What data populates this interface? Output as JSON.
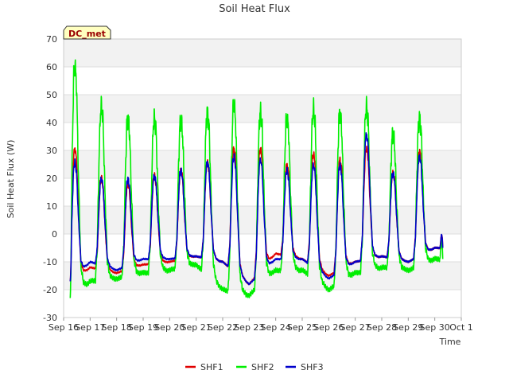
{
  "chart_data": {
    "type": "line",
    "title": "Soil Heat Flux",
    "xlabel": "Time",
    "ylabel": "Soil Heat Flux (W)",
    "badge": "DC_met",
    "ylim": [
      -30,
      70
    ],
    "yticks": [
      -30,
      -20,
      -10,
      0,
      10,
      20,
      30,
      40,
      50,
      60,
      70
    ],
    "xlim": [
      0,
      15
    ],
    "xtick_labels": [
      "Sep 16",
      "Sep 17",
      "Sep 18",
      "Sep 19",
      "Sep 20",
      "Sep 21",
      "Sep 22",
      "Sep 23",
      "Sep 24",
      "Sep 25",
      "Sep 26",
      "Sep 27",
      "Sep 28",
      "Sep 29",
      "Sep 30",
      "Oct 1"
    ],
    "grid": true,
    "legend_position": "bottom-center",
    "data_start": 0.25,
    "data_end": 14.3,
    "day_profile": {
      "phase": [
        0.0,
        0.2,
        0.27,
        0.33,
        0.38,
        0.43,
        0.49,
        0.56,
        0.65,
        0.75,
        0.88,
        1.0
      ],
      "shape": [
        0.0,
        0.0,
        0.2,
        0.65,
        0.95,
        1.0,
        0.9,
        0.5,
        0.1,
        0.02,
        0.0,
        0.0
      ]
    },
    "series": [
      {
        "name": "SHF1",
        "color": "#e00000",
        "width": 1.6,
        "daily_min": [
          -20,
          -12,
          -14,
          -11,
          -10,
          -8,
          -10,
          -18,
          -7,
          -9,
          -15,
          -10,
          -8,
          -10,
          -5
        ],
        "daily_max": [
          31,
          20,
          18,
          21,
          23,
          26,
          31,
          31,
          25,
          29,
          27,
          31,
          22,
          30
        ],
        "start_value": -17,
        "end_value": -5
      },
      {
        "name": "SHF2",
        "color": "#00ee00",
        "width": 1.6,
        "daily_min": [
          -25,
          -17,
          -16,
          -14,
          -13,
          -11,
          -20,
          -22,
          -13,
          -13,
          -20,
          -14,
          -12,
          -13,
          -9
        ],
        "daily_max": [
          61,
          46,
          42,
          42,
          41,
          44,
          47,
          44,
          42,
          45,
          44,
          46,
          36,
          42
        ],
        "start_value": -23,
        "end_value": -9
      },
      {
        "name": "SHF3",
        "color": "#0000cc",
        "width": 1.6,
        "daily_min": [
          -20,
          -10,
          -13,
          -9,
          -9,
          -8,
          -10,
          -18,
          -9,
          -9,
          -16,
          -10,
          -8,
          -10,
          -5
        ],
        "daily_max": [
          26,
          20,
          20,
          21,
          23,
          26,
          28,
          27,
          23,
          25,
          25,
          36,
          22,
          28
        ],
        "start_value": -17,
        "end_value": -5
      }
    ]
  }
}
